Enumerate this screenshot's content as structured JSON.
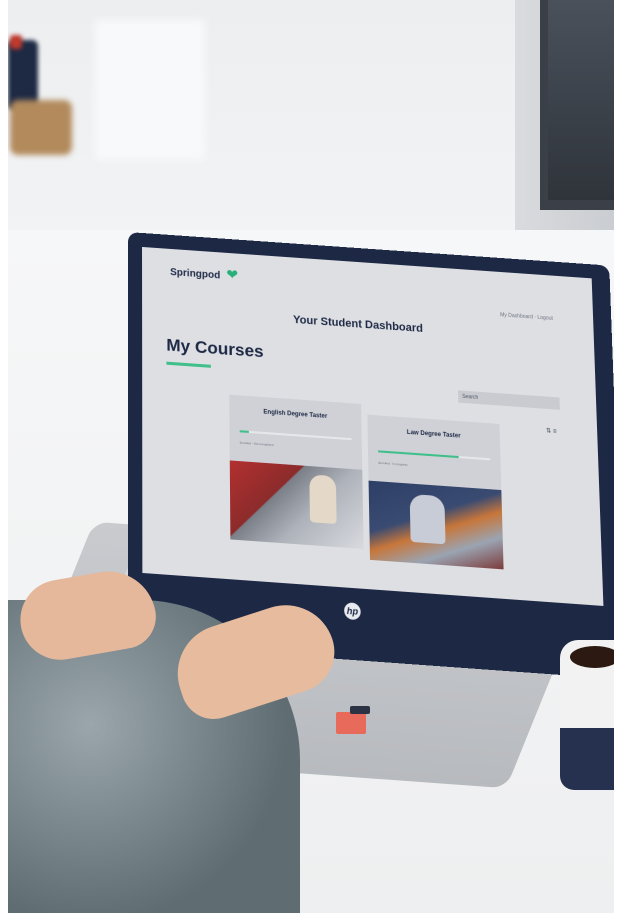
{
  "brand": {
    "name": "Springpod",
    "logo_glyph": "❤"
  },
  "header": {
    "links": "My Dashboard  ·  Logout"
  },
  "dashboard": {
    "title": "Your Student Dashboard",
    "heading": "My Courses",
    "search_placeholder": "Search",
    "sort_label": "⇅ ≡"
  },
  "courses": [
    {
      "title": "English Degree Taster",
      "progress": 0.08,
      "meta": "Enrolled   ·   Not completed"
    },
    {
      "title": "Law Degree Taster",
      "progress": 0.72,
      "meta": "Enrolled   ·   In progress"
    }
  ],
  "laptop": {
    "logo": "hp"
  },
  "colors": {
    "brand_navy": "#1c2844",
    "brand_green": "#3fbf8a",
    "screen_bg": "#dedfe3"
  }
}
